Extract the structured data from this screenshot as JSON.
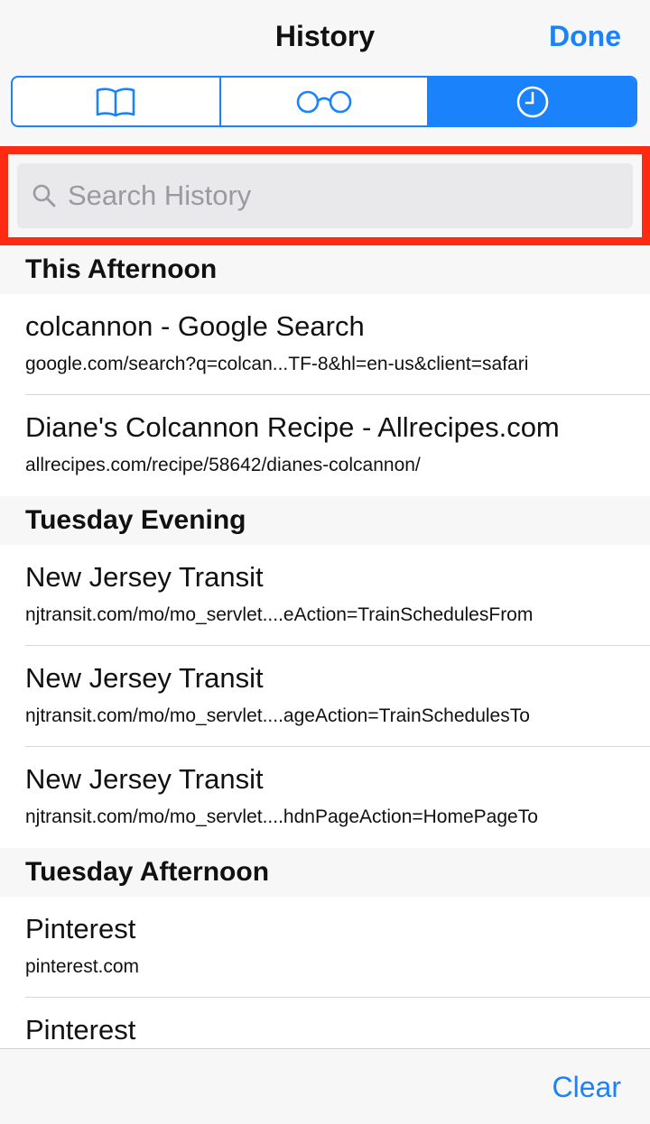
{
  "header": {
    "title": "History",
    "done_label": "Done"
  },
  "segments": [
    {
      "icon": "book-icon",
      "active": false
    },
    {
      "icon": "reading-list-glasses-icon",
      "active": false
    },
    {
      "icon": "clock-history-icon",
      "active": true
    }
  ],
  "search": {
    "placeholder": "Search History",
    "value": ""
  },
  "sections": [
    {
      "header": "This Afternoon",
      "items": [
        {
          "title": "colcannon - Google Search",
          "url": "google.com/search?q=colcan...TF-8&hl=en-us&client=safari"
        },
        {
          "title": "Diane's Colcannon Recipe - Allrecipes.com",
          "url": "allrecipes.com/recipe/58642/dianes-colcannon/"
        }
      ]
    },
    {
      "header": "Tuesday Evening",
      "items": [
        {
          "title": "New Jersey Transit",
          "url": "njtransit.com/mo/mo_servlet....eAction=TrainSchedulesFrom"
        },
        {
          "title": "New Jersey Transit",
          "url": "njtransit.com/mo/mo_servlet....ageAction=TrainSchedulesTo"
        },
        {
          "title": "New Jersey Transit",
          "url": "njtransit.com/mo/mo_servlet....hdnPageAction=HomePageTo"
        }
      ]
    },
    {
      "header": "Tuesday Afternoon",
      "items": [
        {
          "title": "Pinterest",
          "url": "pinterest.com"
        },
        {
          "title": "Pinterest",
          "url": ""
        }
      ]
    }
  ],
  "footer": {
    "clear_label": "Clear"
  },
  "colors": {
    "accent": "#1a82fb",
    "highlight": "#ff2a12"
  }
}
